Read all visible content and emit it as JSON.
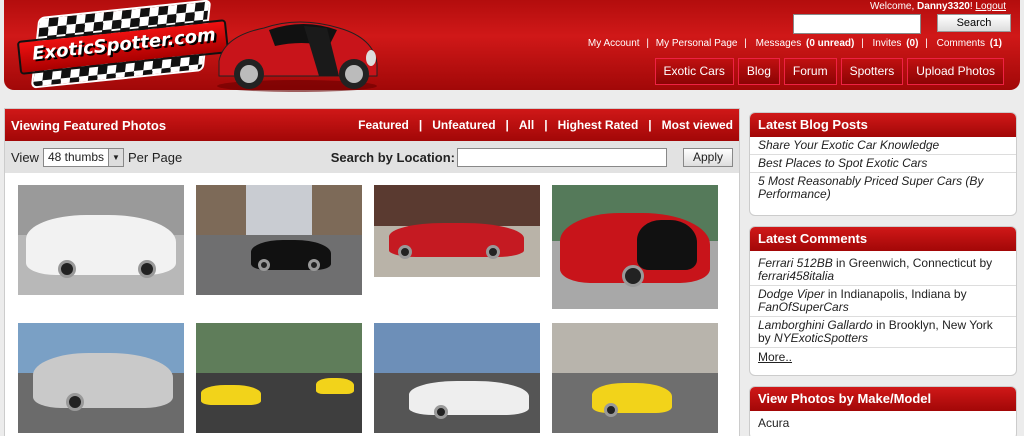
{
  "header": {
    "logo_text": "ExoticSpotter.com",
    "welcome_prefix": "Welcome, ",
    "username": "Danny3320",
    "welcome_suffix": "! ",
    "logout": "Logout",
    "search_placeholder": "",
    "search_button": "Search",
    "account_links": [
      "My Account",
      "My Personal Page",
      "Messages",
      "Invites",
      "Comments"
    ],
    "messages_count": "(0 unread)",
    "invites_count": "(0)",
    "comments_count": "(1)",
    "separator": "|",
    "nav": [
      "Exotic Cars",
      "Blog",
      "Forum",
      "Spotters",
      "Upload Photos"
    ]
  },
  "main": {
    "title": "Viewing Featured Photos",
    "filters": [
      "Featured",
      "Unfeatured",
      "All",
      "Highest Rated",
      "Most viewed"
    ],
    "view_label": "View",
    "thumbs_option": "48 thumbs",
    "per_page": "Per Page",
    "location_label": "Search by Location:",
    "location_value": "",
    "apply": "Apply"
  },
  "sidebar": {
    "blog_title": "Latest Blog Posts",
    "blog_posts": [
      "Share Your Exotic Car Knowledge",
      "Best Places to Spot Exotic Cars",
      "5 Most Reasonably Priced Super Cars (By Performance)"
    ],
    "comments_title": "Latest Comments",
    "comments": [
      {
        "car": "Ferrari 512BB",
        "in_text": " in Greenwich, Connecticut by ",
        "user": "ferrari458italia"
      },
      {
        "car": "Dodge Viper",
        "in_text": " in Indianapolis, Indiana by ",
        "user": "FanOfSuperCars"
      },
      {
        "car": "Lamborghini Gallardo",
        "in_text": " in Brooklyn, New York by ",
        "user": "NYExoticSpotters"
      }
    ],
    "more": "More..",
    "make_title": "View Photos by Make/Model",
    "makes": [
      "Acura"
    ]
  },
  "colors": {
    "brand_red": "#c41212",
    "sidebar_bg": "#ffffff"
  }
}
